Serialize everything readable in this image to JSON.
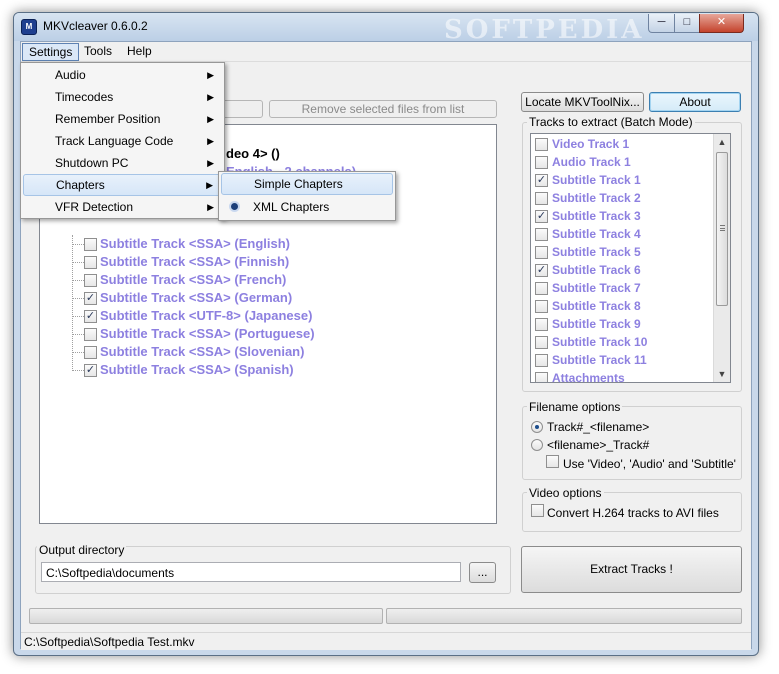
{
  "window": {
    "title": "MKVcleaver 0.6.0.2",
    "watermark": "SOFTPEDIA"
  },
  "menubar": {
    "settings": "Settings",
    "tools": "Tools",
    "help": "Help"
  },
  "settings_menu": [
    {
      "label": "Audio"
    },
    {
      "label": "Timecodes"
    },
    {
      "label": "Remember Position"
    },
    {
      "label": "Track Language Code"
    },
    {
      "label": "Shutdown PC"
    },
    {
      "label": "Chapters"
    },
    {
      "label": "VFR Detection"
    }
  ],
  "chapters_submenu": [
    {
      "label": "Simple Chapters",
      "selected": false
    },
    {
      "label": "XML Chapters",
      "selected": true
    }
  ],
  "toolbar": {
    "remove_selected": "Remove selected files from list",
    "locate": "Locate MKVToolNix...",
    "about": "About"
  },
  "tree": {
    "partial_rows": [
      {
        "text": "deo 4> ()"
      },
      {
        "text": "English - 2 channels)"
      }
    ],
    "rows": [
      {
        "label": "Subtitle Track <SSA> (English)",
        "checked": false
      },
      {
        "label": "Subtitle Track <SSA> (Finnish)",
        "checked": false
      },
      {
        "label": "Subtitle Track <SSA> (French)",
        "checked": false
      },
      {
        "label": "Subtitle Track <SSA> (German)",
        "checked": true
      },
      {
        "label": "Subtitle Track <UTF-8> (Japanese)",
        "checked": true
      },
      {
        "label": "Subtitle Track <SSA> (Portuguese)",
        "checked": false
      },
      {
        "label": "Subtitle Track <SSA> (Slovenian)",
        "checked": false
      },
      {
        "label": "Subtitle Track <SSA> (Spanish)",
        "checked": true
      }
    ]
  },
  "tracks_panel": {
    "title": "Tracks to extract (Batch Mode)",
    "items": [
      {
        "label": "Video Track 1",
        "checked": false
      },
      {
        "label": "Audio Track 1",
        "checked": false
      },
      {
        "label": "Subtitle Track 1",
        "checked": true
      },
      {
        "label": "Subtitle Track 2",
        "checked": false
      },
      {
        "label": "Subtitle Track 3",
        "checked": true
      },
      {
        "label": "Subtitle Track 4",
        "checked": false
      },
      {
        "label": "Subtitle Track 5",
        "checked": false
      },
      {
        "label": "Subtitle Track 6",
        "checked": true
      },
      {
        "label": "Subtitle Track 7",
        "checked": false
      },
      {
        "label": "Subtitle Track 8",
        "checked": false
      },
      {
        "label": "Subtitle Track 9",
        "checked": false
      },
      {
        "label": "Subtitle Track 10",
        "checked": false
      },
      {
        "label": "Subtitle Track 11",
        "checked": false
      },
      {
        "label": "Attachments",
        "checked": false
      }
    ]
  },
  "filename_options": {
    "title": "Filename options",
    "opt1": "Track#_<filename>",
    "opt2": "<filename>_Track#",
    "use_names": "Use 'Video', 'Audio' and 'Subtitle'"
  },
  "video_options": {
    "title": "Video options",
    "convert": "Convert H.264 tracks to AVI files"
  },
  "output": {
    "label": "Output directory",
    "path": "C:\\Softpedia\\documents",
    "browse": "..."
  },
  "extract_button": "Extract Tracks !",
  "status": "C:\\Softpedia\\Softpedia Test.mkv",
  "checkmark": "✓"
}
